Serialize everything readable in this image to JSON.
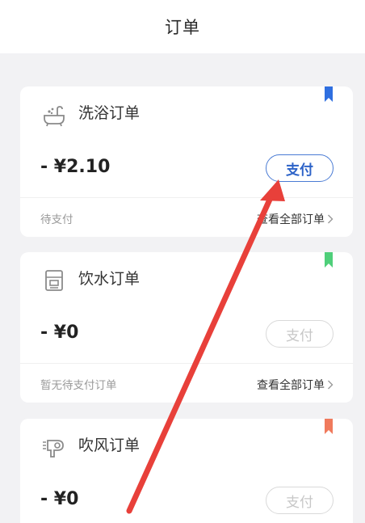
{
  "header": {
    "title": "订单"
  },
  "cards": [
    {
      "title": "洗浴订单",
      "icon": "bath-icon",
      "amount": "- ¥2.10",
      "pay_label": "支付",
      "pay_enabled": true,
      "status": "待支付",
      "view_all": "查看全部订单",
      "bookmark_color": "#2f6fe0"
    },
    {
      "title": "饮水订单",
      "icon": "water-dispenser-icon",
      "amount": "- ¥0",
      "pay_label": "支付",
      "pay_enabled": false,
      "status": "暂无待支付订单",
      "view_all": "查看全部订单",
      "bookmark_color": "#4fcf7a"
    },
    {
      "title": "吹风订单",
      "icon": "hair-dryer-icon",
      "amount": "- ¥0",
      "pay_label": "支付",
      "pay_enabled": false,
      "bookmark_color": "#f07a5c"
    }
  ],
  "annotation": {
    "arrow_color": "#e8403a"
  }
}
